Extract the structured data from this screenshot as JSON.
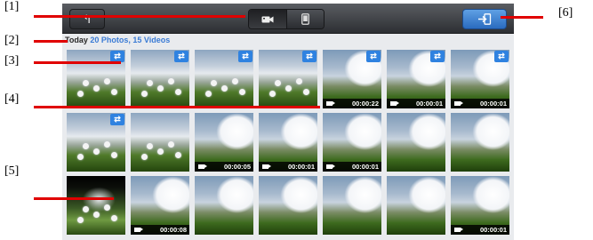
{
  "callouts": [
    "[1]",
    "[2]",
    "[3]",
    "[4]",
    "[5]",
    "[6]"
  ],
  "toolbar": {
    "back_glyph": "↰",
    "segments": [
      "video-camera-icon",
      "phone-icon"
    ],
    "import_icon": "import-icon"
  },
  "summary": {
    "day": "Today",
    "counts": "20 Photos, 15 Videos"
  },
  "grid": {
    "rows": [
      [
        {
          "kind": "photo",
          "badge": "⇄"
        },
        {
          "kind": "photo",
          "badge": "⇄"
        },
        {
          "kind": "photo",
          "badge": "⇄"
        },
        {
          "kind": "photo",
          "badge": "⇄"
        },
        {
          "kind": "video",
          "badge": "⇄",
          "duration": "00:00:22"
        },
        {
          "kind": "video",
          "badge": "⇄",
          "duration": "00:00:01"
        },
        {
          "kind": "video",
          "badge": "⇄",
          "duration": "00:00:01"
        }
      ],
      [
        {
          "kind": "photo",
          "badge": "⇄"
        },
        {
          "kind": "photo"
        },
        {
          "kind": "video",
          "duration": "00:00:05"
        },
        {
          "kind": "video",
          "duration": "00:00:01"
        },
        {
          "kind": "video",
          "duration": "00:00:01"
        },
        {
          "kind": "video"
        },
        {
          "kind": "video"
        }
      ],
      [
        {
          "kind": "last"
        },
        {
          "kind": "video",
          "duration": "00:00:08"
        },
        {
          "kind": "video"
        },
        {
          "kind": "video"
        },
        {
          "kind": "video"
        },
        {
          "kind": "video"
        },
        {
          "kind": "video",
          "duration": "00:00:01"
        }
      ]
    ]
  },
  "colors": {
    "callout_line": "#e00000",
    "badge": "#2f82e0",
    "import_button": "#3a7bd5"
  }
}
